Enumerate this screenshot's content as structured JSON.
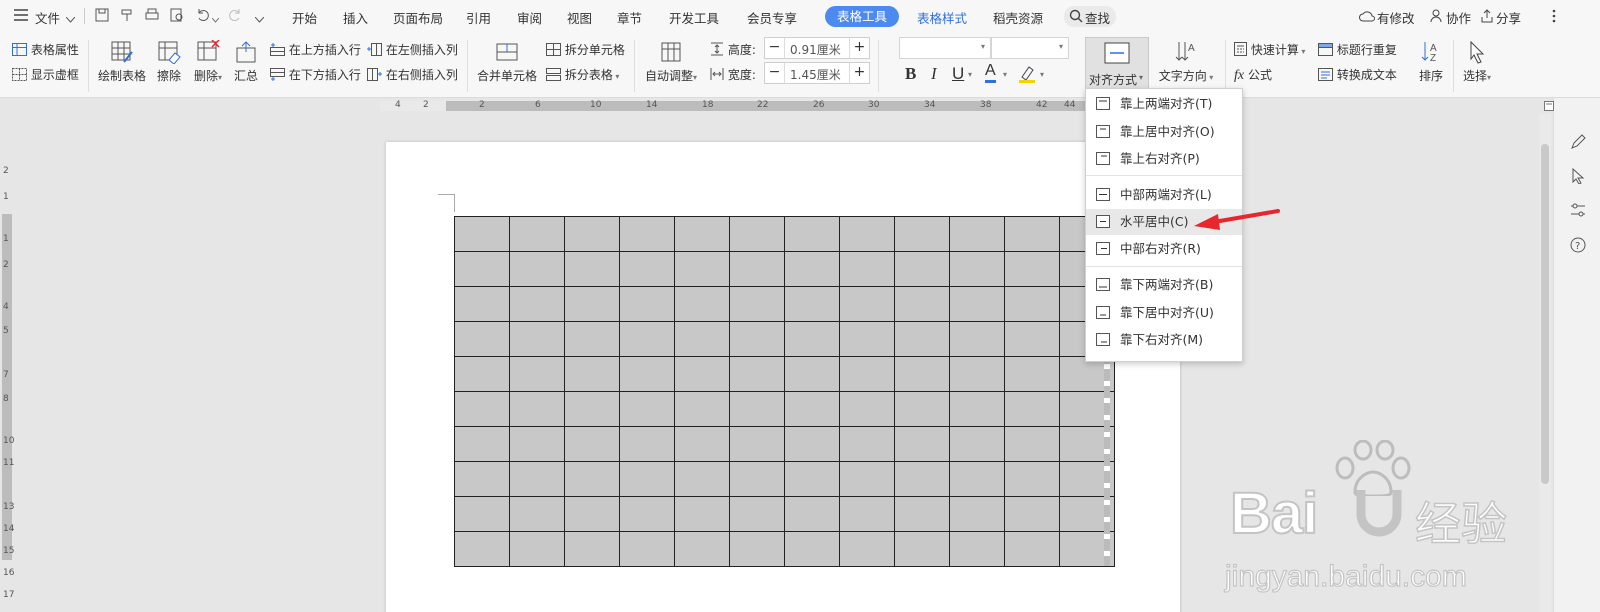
{
  "menubar": {
    "file": "文件",
    "tabs": [
      "开始",
      "插入",
      "页面布局",
      "引用",
      "审阅",
      "视图",
      "章节",
      "开发工具",
      "会员专享",
      "表格工具",
      "表格样式",
      "稻壳资源"
    ],
    "search": "查找",
    "modify": "有修改",
    "collab": "协作",
    "share": "分享"
  },
  "ribbon": {
    "table_props": "表格属性",
    "show_gridlines": "显示虚框",
    "draw_table": "绘制表格",
    "erase": "擦除",
    "delete": "删除",
    "summary": "汇总",
    "insert_above": "在上方插入行",
    "insert_below": "在下方插入行",
    "insert_left": "在左侧插入列",
    "insert_right": "在右侧插入列",
    "merge_cells": "合并单元格",
    "split_cells": "拆分单元格",
    "split_table": "拆分表格",
    "auto_fit": "自动调整",
    "height_label": "高度:",
    "height_value": "0.91厘米",
    "width_label": "宽度:",
    "width_value": "1.45厘米",
    "align": "对齐方式",
    "text_direction": "文字方向",
    "quick_calc": "快速计算",
    "formula": "公式",
    "title_repeat": "标题行重复",
    "to_text": "转换成文本",
    "sort": "排序",
    "select": "选择"
  },
  "ruler": {
    "h_ticks": [
      "4",
      "2",
      "2",
      "6",
      "10",
      "14",
      "18",
      "22",
      "26",
      "30",
      "34",
      "38",
      "42",
      "44"
    ],
    "v_ticks": [
      "2",
      "1",
      "1",
      "2",
      "4",
      "5",
      "7",
      "8",
      "10",
      "11",
      "13",
      "14",
      "15",
      "16",
      "17"
    ]
  },
  "alignment_menu": {
    "items": [
      "靠上两端对齐(T)",
      "靠上居中对齐(O)",
      "靠上右对齐(P)",
      "中部两端对齐(L)",
      "水平居中(C)",
      "中部右对齐(R)",
      "靠下两端对齐(B)",
      "靠下居中对齐(U)",
      "靠下右对齐(M)"
    ],
    "highlighted": "水平居中(C)"
  },
  "table": {
    "rows": 10,
    "cols": 12
  },
  "watermark": {
    "brand": "Bai",
    "brand2": "经验",
    "url": "jingyan.baidu.com"
  },
  "colors": {
    "accent": "#4d8af0",
    "arrow": "#e8262d",
    "cell_fill": "#c8c8c8"
  }
}
